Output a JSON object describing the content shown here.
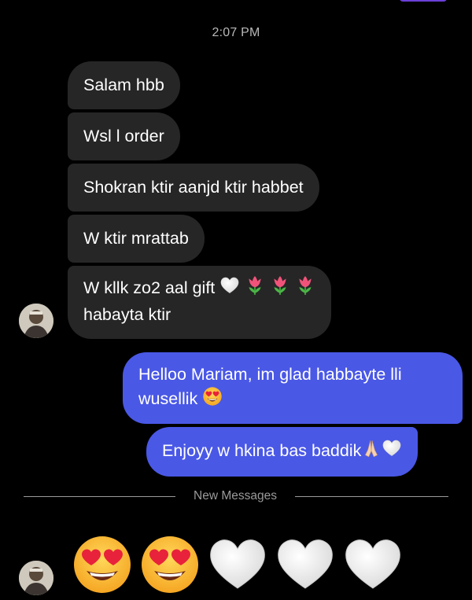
{
  "status": {
    "timestamp": "2:07 PM"
  },
  "messages": {
    "received": [
      {
        "text": "Salam hbb"
      },
      {
        "text": "Wsl l order"
      },
      {
        "text": "Shokran ktir aanjd ktir habbet"
      },
      {
        "text": "W ktir mrattab"
      },
      {
        "text_line1": "W kllk zo2 aal gift",
        "text_line2": "habayta ktir",
        "emojis": [
          "white-heart",
          "tulip",
          "tulip",
          "tulip"
        ]
      }
    ],
    "sent": [
      {
        "text": "Helloo Mariam, im glad habbayte lli wusellik",
        "emojis": [
          "heart-eyes"
        ]
      },
      {
        "text": "Enjoyy w hkina bas baddik",
        "emojis": [
          "folded-hands",
          "white-heart"
        ]
      }
    ]
  },
  "divider": {
    "label": "New Messages"
  },
  "reaction_emojis": [
    "heart-eyes",
    "heart-eyes",
    "white-heart",
    "white-heart",
    "white-heart"
  ],
  "colors": {
    "background": "#000000",
    "received_bubble": "#262626",
    "sent_bubble": "#4a58e6",
    "meta_text": "#b8b8b8"
  }
}
